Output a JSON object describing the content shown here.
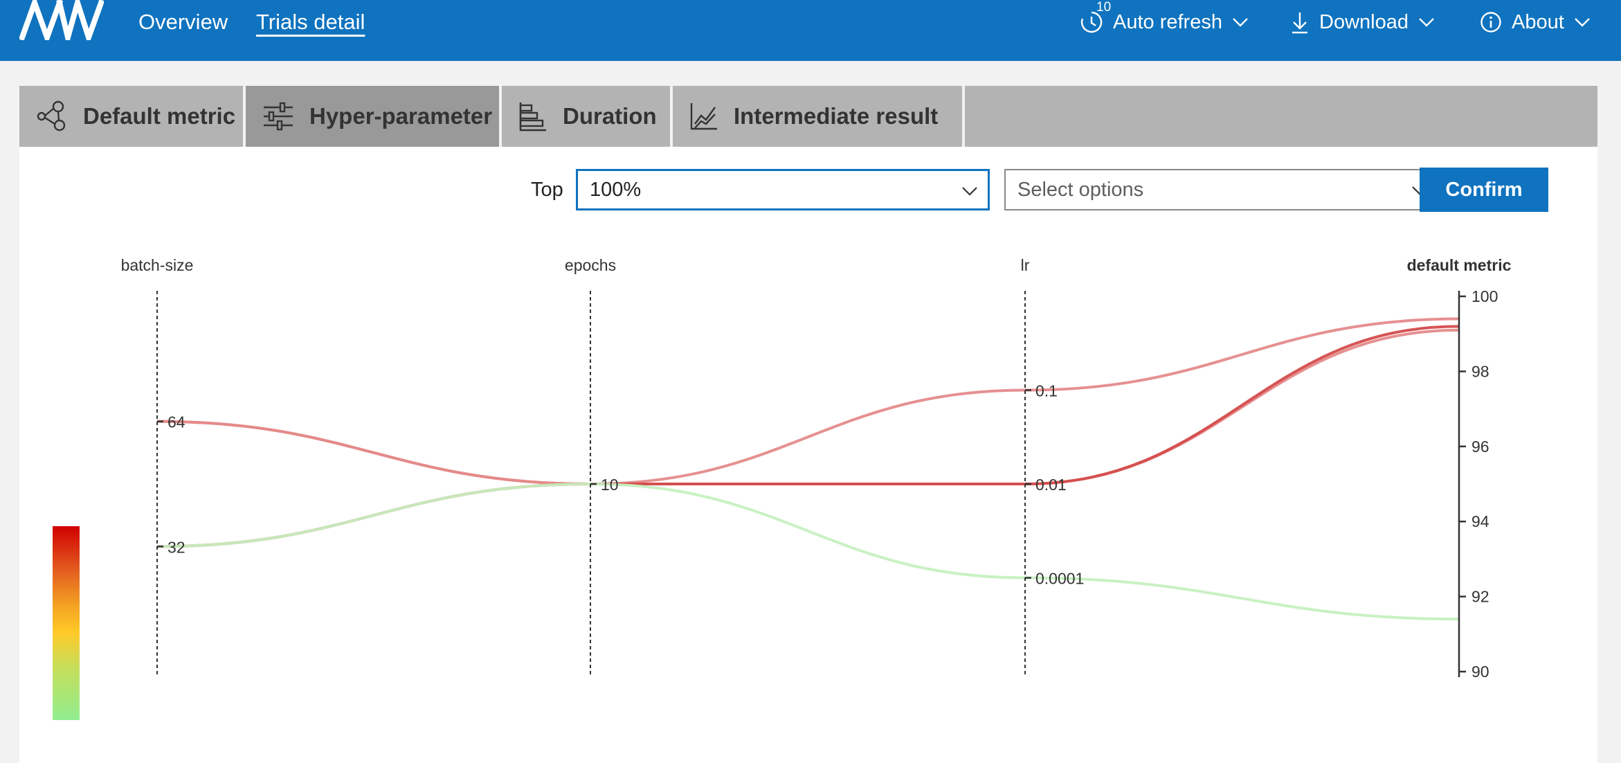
{
  "header": {
    "nav": [
      "Overview",
      "Trials detail"
    ],
    "active_nav": "Trials detail",
    "auto_refresh_label": "Auto refresh",
    "auto_refresh_badge": "10",
    "download_label": "Download",
    "about_label": "About",
    "accent_color": "#0f73bf"
  },
  "tabs": [
    {
      "label": "Default metric",
      "icon": "scatter-nodes-icon"
    },
    {
      "label": "Hyper-parameter",
      "icon": "sliders-icon"
    },
    {
      "label": "Duration",
      "icon": "bar-chart-horizontal-icon"
    },
    {
      "label": "Intermediate result",
      "icon": "line-chart-icon"
    }
  ],
  "selected_tab": "Hyper-parameter",
  "filter": {
    "top_label": "Top",
    "top_value": "100%",
    "select_placeholder": "Select options",
    "confirm_label": "Confirm"
  },
  "chart_data": {
    "type": "parallel-coordinates",
    "axes": [
      {
        "name": "batch-size",
        "ticks": [
          "32",
          "64"
        ]
      },
      {
        "name": "epochs",
        "ticks": [
          "10"
        ]
      },
      {
        "name": "lr",
        "ticks": [
          "0.0001",
          "0.01",
          "0.1"
        ]
      },
      {
        "name": "default metric",
        "ticks": [
          "90",
          "92",
          "94",
          "96",
          "98",
          "100"
        ],
        "range": [
          90,
          100
        ]
      }
    ],
    "series": [
      {
        "values": [
          "64",
          "10",
          "0.1",
          99.4
        ],
        "color": "#e58a8a"
      },
      {
        "values": [
          "64",
          "10",
          "0.01",
          99.1
        ],
        "color": "#e58a8a"
      },
      {
        "values": [
          "32",
          "10",
          "0.01",
          99.2
        ],
        "color": "#d44c4c"
      },
      {
        "values": [
          "32",
          "10",
          "0.0001",
          91.4
        ],
        "color": "#c6f0c0"
      }
    ],
    "colorbar": {
      "min_color": "#90ee90",
      "max_color": "#d00000"
    }
  }
}
